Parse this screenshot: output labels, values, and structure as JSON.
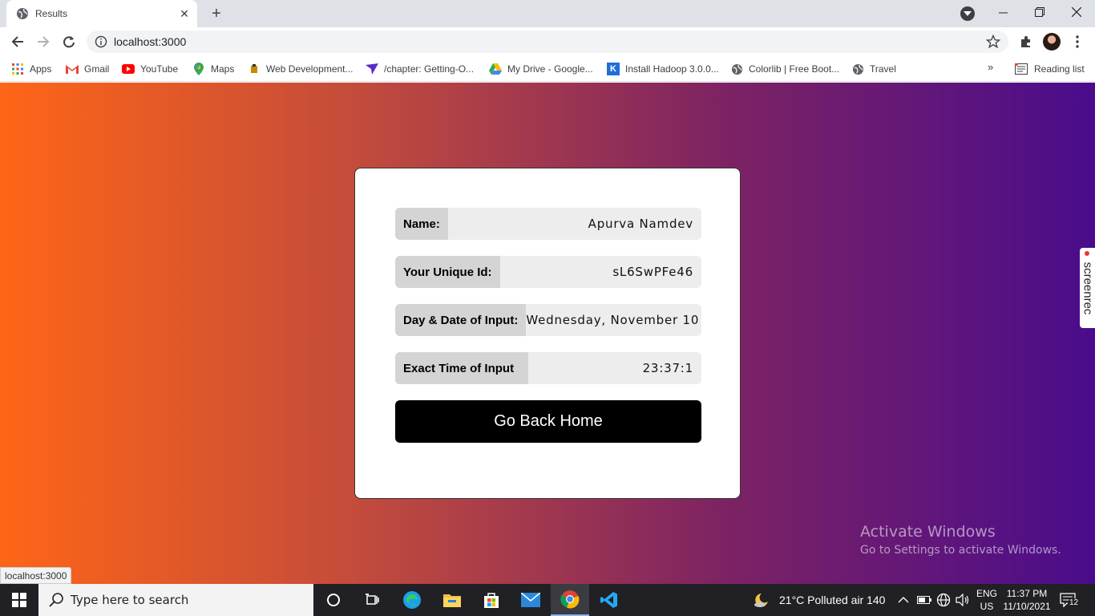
{
  "browser": {
    "tab": {
      "title": "Results"
    },
    "address": {
      "url": "localhost:3000"
    },
    "bookmarks": [
      {
        "label": "Apps",
        "icon": "apps-grid-icon"
      },
      {
        "label": "Gmail",
        "icon": "gmail-icon"
      },
      {
        "label": "YouTube",
        "icon": "youtube-icon"
      },
      {
        "label": "Maps",
        "icon": "maps-icon"
      },
      {
        "label": "Web Development...",
        "icon": "bookmark-icon"
      },
      {
        "label": "/chapter: Getting-O...",
        "icon": "bookmark-icon"
      },
      {
        "label": "My Drive - Google...",
        "icon": "google-drive-icon"
      },
      {
        "label": "Install Hadoop 3.0.0...",
        "icon": "k-icon"
      },
      {
        "label": "Colorlib | Free Boot...",
        "icon": "globe-icon"
      },
      {
        "label": "Travel",
        "icon": "globe-icon"
      }
    ],
    "bookmarks_more": "»",
    "reading_list": "Reading list",
    "status_url": "localhost:3000"
  },
  "card": {
    "rows": [
      {
        "label": "Name:",
        "value": "Apurva Namdev"
      },
      {
        "label": "Your Unique Id:",
        "value": "sL6SwPFe46"
      },
      {
        "label": "Day & Date of Input:",
        "value": "Wednesday, November 10"
      },
      {
        "label": "Exact Time of Input",
        "value": "23:37:1"
      }
    ],
    "button": "Go Back Home"
  },
  "screenrec": {
    "label": "screenrec"
  },
  "watermark": {
    "title": "Activate Windows",
    "subtitle": "Go to Settings to activate Windows."
  },
  "taskbar": {
    "search_placeholder": "Type here to search",
    "weather": "21°C  Polluted air 140",
    "lang_top": "ENG",
    "lang_bottom": "US",
    "time": "11:37 PM",
    "date": "11/10/2021",
    "notifications": "12"
  }
}
